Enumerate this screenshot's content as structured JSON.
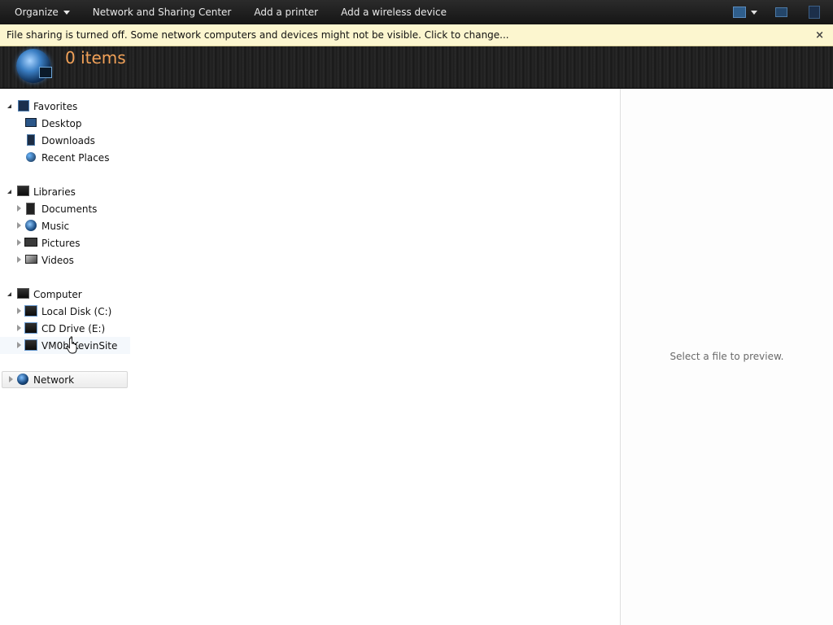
{
  "toolbar": {
    "organize": "Organize",
    "network_center": "Network and Sharing Center",
    "add_printer": "Add a printer",
    "add_wireless": "Add a wireless device",
    "icons": [
      "change-view-icon",
      "more-options-caret-icon",
      "preview-pane-icon",
      "help-icon"
    ]
  },
  "infobar": {
    "message": "File sharing is turned off. Some network computers and devices might not be visible. Click to change...",
    "close": "×"
  },
  "header": {
    "item_count": "0 items"
  },
  "nav": {
    "favorites": {
      "label": "Favorites",
      "items": [
        "Desktop",
        "Downloads",
        "Recent Places"
      ]
    },
    "libraries": {
      "label": "Libraries",
      "items": [
        "Documents",
        "Music",
        "Pictures",
        "Videos"
      ]
    },
    "computer": {
      "label": "Computer",
      "items": [
        "Local Disk (C:)",
        "CD Drive (E:)",
        "VM0b KevinSite"
      ]
    },
    "network": {
      "label": "Network"
    }
  },
  "preview": {
    "message": "Select a file to preview."
  },
  "colors": {
    "toolbar_bg": "#1f1f1f",
    "infobar_bg": "#fcf6cf",
    "item_count": "#f1a158"
  }
}
